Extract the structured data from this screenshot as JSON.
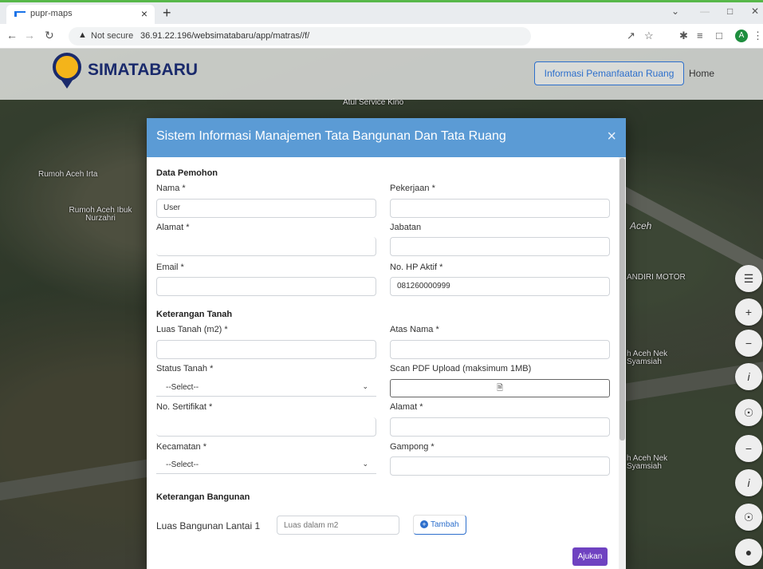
{
  "browser": {
    "tab_title": "pupr-maps",
    "tab_close": "×",
    "new_tab": "+",
    "not_secure": "Not secure",
    "url": "36.91.22.196/websimatabaru/app/matras//f/",
    "avatar_letter": "A"
  },
  "navbar": {
    "brand": "SIMATABARU",
    "info_button": "Informasi Pemanfaatan Ruang",
    "home": "Home"
  },
  "map_labels": {
    "rumoh_aceh_irta": "Rumoh Aceh Irta",
    "rumoh_aceh_ibuk": "Rumoh Aceh Ibuk Nurzahri",
    "aceh_road": "Aceh",
    "mandiri_motor": "ANDIRI MOTOR",
    "aceh_nek_1": "h Aceh Nek Syamsiah",
    "aceh_nek_2": "h Aceh Nek Syamsiah",
    "top_label": "Atul Service Kino"
  },
  "map_controls": [
    "layers-icon",
    "zoom-in-icon",
    "zoom-out-icon",
    "info-icon",
    "globe-icon",
    "zoom-out-icon",
    "info-icon",
    "globe-icon",
    "locate-icon"
  ],
  "modal": {
    "title": "Sistem Informasi Manajemen Tata Bangunan Dan Tata Ruang",
    "close": "×",
    "section_pemohon": "Data Pemohon",
    "nama_label": "Nama *",
    "nama_value": "User",
    "pekerjaan_label": "Pekerjaan *",
    "pekerjaan_value": "",
    "alamat_label": "Alamat *",
    "alamat_value": "",
    "jabatan_label": "Jabatan",
    "jabatan_value": "",
    "email_label": "Email *",
    "email_value": "",
    "hp_label": "No. HP Aktif *",
    "hp_value": "081260000999",
    "section_tanah": "Keterangan Tanah",
    "luas_tanah_label": "Luas Tanah (m2) *",
    "luas_tanah_value": "",
    "atas_nama_label": "Atas Nama *",
    "atas_nama_value": "",
    "status_tanah_label": "Status Tanah *",
    "status_tanah_value": "--Select--",
    "scan_label": "Scan PDF Upload (maksimum 1MB)",
    "sertifikat_label": "No. Sertifikat *",
    "sertifikat_value": "",
    "alamat_tanah_label": "Alamat *",
    "alamat_tanah_value": "",
    "kecamatan_label": "Kecamatan *",
    "kecamatan_value": "--Select--",
    "gampong_label": "Gampong *",
    "gampong_value": "",
    "section_bangunan": "Keterangan Bangunan",
    "luas_lantai_label": "Luas Bangunan Lantai 1",
    "luas_lantai_placeholder": "Luas dalam m2",
    "tambah": "Tambah",
    "ajukan": "Ajukan"
  },
  "colors": {
    "modal_header": "#5b9bd5",
    "primary": "#2d6fcc",
    "submit": "#6f42c1",
    "brand": "#1a2a6c"
  }
}
